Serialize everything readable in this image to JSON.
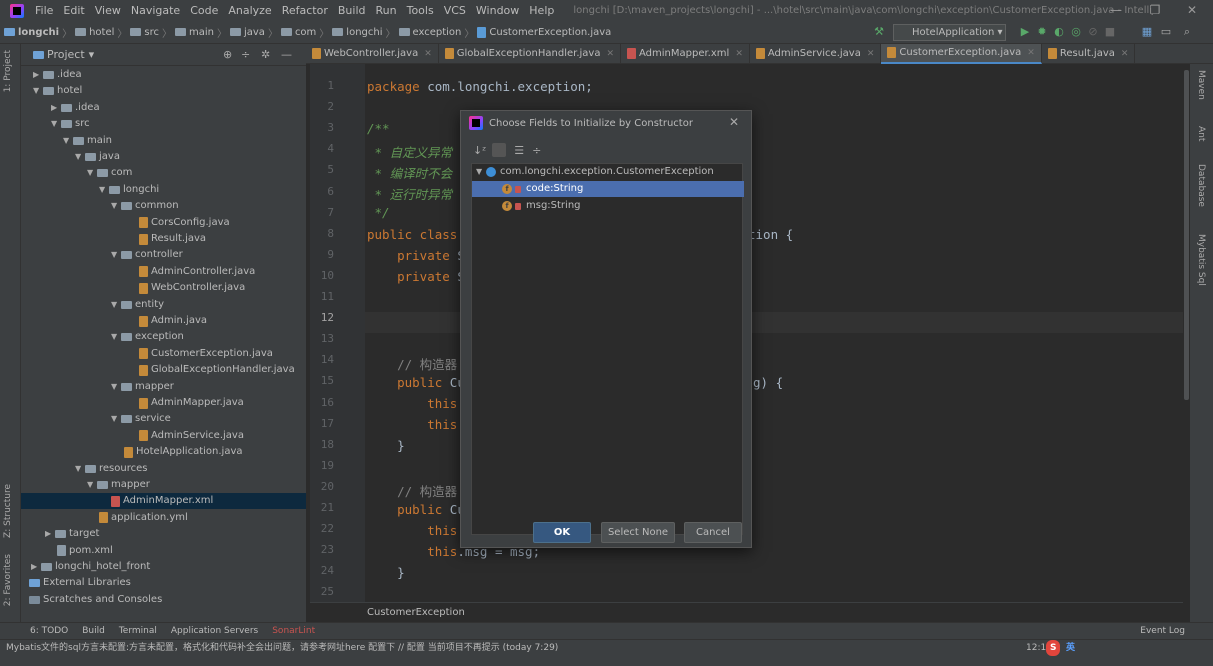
{
  "window": {
    "title": "longchi [D:\\maven_projects\\longchi] - ...\\hotel\\src\\main\\java\\com\\longchi\\exception\\CustomerException.java - IntelliJ IDEA",
    "menu": [
      "File",
      "Edit",
      "View",
      "Navigate",
      "Code",
      "Analyze",
      "Refactor",
      "Build",
      "Run",
      "Tools",
      "VCS",
      "Window",
      "Help"
    ],
    "minimize": "—",
    "maximize": "❐",
    "close": "✕"
  },
  "breadcrumbs": [
    "longchi",
    "hotel",
    "src",
    "main",
    "java",
    "com",
    "longchi",
    "exception",
    "CustomerException.java"
  ],
  "run_config": "HotelApplication",
  "project_panel": {
    "title": "Project",
    "tree": [
      {
        "label": ".idea",
        "icon": "folder",
        "expanded": false
      },
      {
        "label": "hotel",
        "icon": "folder",
        "expanded": true
      },
      {
        "label": ".idea",
        "icon": "folder",
        "expanded": false
      },
      {
        "label": "src",
        "icon": "folder",
        "expanded": true
      },
      {
        "label": "main",
        "icon": "folder",
        "expanded": true
      },
      {
        "label": "java",
        "icon": "folder",
        "expanded": true
      },
      {
        "label": "com",
        "icon": "folder",
        "expanded": true
      },
      {
        "label": "longchi",
        "icon": "folder",
        "expanded": true
      },
      {
        "label": "common",
        "icon": "folder",
        "expanded": true
      },
      {
        "label": "CorsConfig.java",
        "icon": "java-file"
      },
      {
        "label": "Result.java",
        "icon": "java-file"
      },
      {
        "label": "controller",
        "icon": "folder",
        "expanded": true
      },
      {
        "label": "AdminController.java",
        "icon": "java-file"
      },
      {
        "label": "WebController.java",
        "icon": "java-file"
      },
      {
        "label": "entity",
        "icon": "folder",
        "expanded": true
      },
      {
        "label": "Admin.java",
        "icon": "java-file"
      },
      {
        "label": "exception",
        "icon": "folder",
        "expanded": true
      },
      {
        "label": "CustomerException.java",
        "icon": "java-file"
      },
      {
        "label": "GlobalExceptionHandler.java",
        "icon": "java-file"
      },
      {
        "label": "mapper",
        "icon": "folder",
        "expanded": true
      },
      {
        "label": "AdminMapper.java",
        "icon": "java-file"
      },
      {
        "label": "service",
        "icon": "folder",
        "expanded": true
      },
      {
        "label": "AdminService.java",
        "icon": "java-file"
      },
      {
        "label": "HotelApplication.java",
        "icon": "java-file"
      },
      {
        "label": "resources",
        "icon": "folder",
        "expanded": true
      },
      {
        "label": "mapper",
        "icon": "folder",
        "expanded": true
      },
      {
        "label": "AdminMapper.xml",
        "icon": "xml-file",
        "selected": true
      },
      {
        "label": "application.yml",
        "icon": "yml-file"
      },
      {
        "label": "target",
        "icon": "folder",
        "expanded": false
      },
      {
        "label": "pom.xml",
        "icon": "maven-file"
      },
      {
        "label": "longchi_hotel_front",
        "icon": "folder",
        "expanded": false
      },
      {
        "label": "External Libraries",
        "icon": "library",
        "expanded": false
      },
      {
        "label": "Scratches and Consoles",
        "icon": "scratch"
      }
    ]
  },
  "left_strip": {
    "project": "1: Project",
    "structure": "Z: Structure",
    "favorites": "2: Favorites"
  },
  "right_strip": {
    "maven": "Maven",
    "ant": "Ant",
    "database": "Database",
    "mybatis": "Mybatis Sql"
  },
  "tabs": [
    {
      "label": "WebController.java",
      "icon": "java-file"
    },
    {
      "label": "GlobalExceptionHandler.java",
      "icon": "java-file"
    },
    {
      "label": "AdminMapper.xml",
      "icon": "xml-file"
    },
    {
      "label": "AdminService.java",
      "icon": "java-file"
    },
    {
      "label": "CustomerException.java",
      "icon": "java-file",
      "active": true
    },
    {
      "label": "Result.java",
      "icon": "java-file"
    }
  ],
  "editor": {
    "lines": [
      "1",
      "2",
      "3",
      "4",
      "5",
      "6",
      "7",
      "8",
      "9",
      "10",
      "11",
      "12",
      "13",
      "14",
      "15",
      "16",
      "17",
      "18",
      "19",
      "20",
      "21",
      "22",
      "23",
      "24",
      "25"
    ],
    "code": {
      "l1a": "package ",
      "l1b": "com.longchi.exception;",
      "l3": "/**",
      "l4": " * 自定义异常",
      "l5": " * 编译时不会",
      "l6": " * 运行时异常",
      "l7": " */",
      "l8a": "public class ",
      "l8b": "S",
      "l8c": "tion {",
      "l9a": "    private ",
      "l9b": "S",
      "l10a": "    private ",
      "l10b": "S",
      "l14": "    // 构造器",
      "l15a": "    public ",
      "l15b": "Cu",
      "l15c": "g) {",
      "l16": "        this.",
      "l17": "        this.",
      "l18": "    }",
      "l20": "    // 构造器",
      "l21a": "    public ",
      "l21b": "Cu",
      "l22": "        this.",
      "l23a": "        this",
      "l23b": ".msg = msg;",
      "l24": "    }"
    },
    "breadcrumb": "CustomerException",
    "current_line": "12"
  },
  "dialog": {
    "title": "Choose Fields to Initialize by Constructor",
    "close": "✕",
    "class_node": "com.longchi.exception.CustomerException",
    "fields": [
      {
        "label": "code:String",
        "selected": true
      },
      {
        "label": "msg:String",
        "selected": false
      }
    ],
    "buttons": {
      "ok": "OK",
      "select_none": "Select None",
      "cancel": "Cancel"
    }
  },
  "bottom_tools": [
    "6: TODO",
    "Build",
    "Terminal",
    "Application Servers",
    "SonarLint"
  ],
  "event_log": "Event Log",
  "status": {
    "message": "Mybatis文件的sql方言未配置:方言未配置，格式化和代码补全会出问题，请参考网址here 配置下 // 配置   当前项目不再提示 (today 7:29)",
    "position": "12:1",
    "ime": "英"
  },
  "colors": {
    "accent": "#4b6eaf",
    "keyword": "#cc7832",
    "comment": "#808080",
    "doc": "#629755"
  }
}
